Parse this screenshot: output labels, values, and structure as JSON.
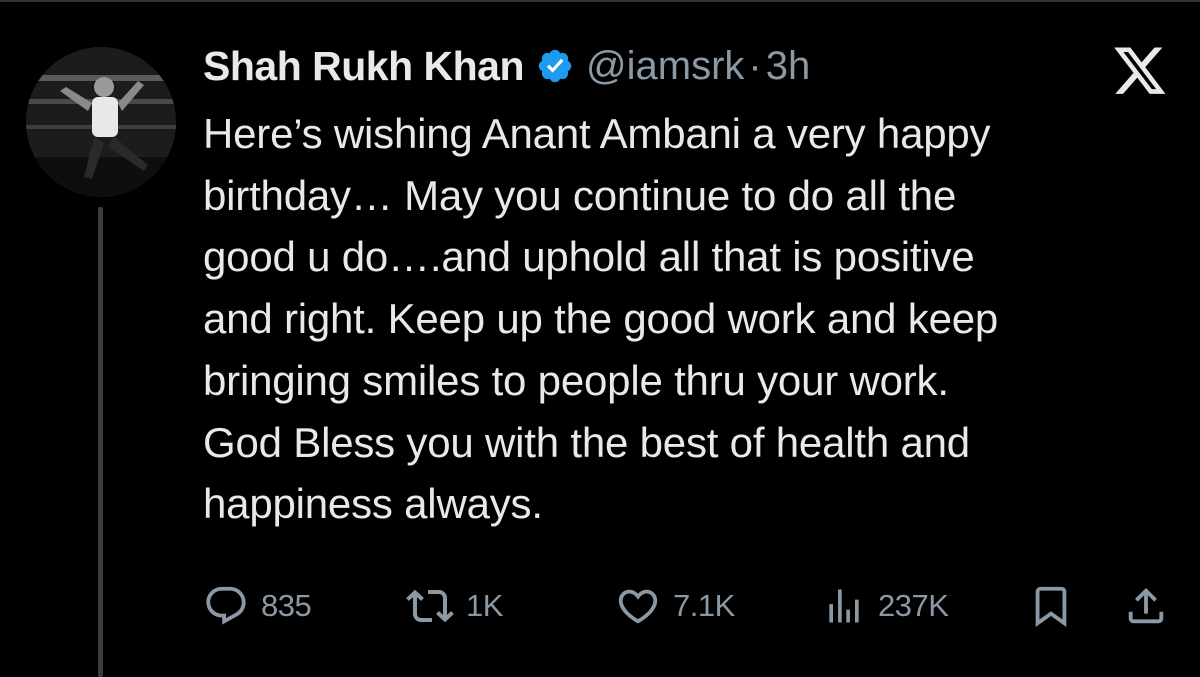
{
  "tweet": {
    "author_name": "Shah Rukh Khan",
    "handle": "@iamsrk",
    "separator": "·",
    "time": "3h",
    "text": "Here’s wishing Anant Ambani a very happy\nbirthday… May you continue to do all the\ngood u do….and uphold all that is positive\nand right. Keep up the good work and keep\nbringing smiles to people thru your work.\nGod Bless you with the best of health and\nhappiness always.",
    "verified_color": "#1d9bf0"
  },
  "icons": {
    "verified": "verified-badge-icon",
    "platform": "x-logo-icon",
    "reply": "reply-icon",
    "retweet": "retweet-icon",
    "like": "heart-icon",
    "views": "views-icon",
    "bookmark": "bookmark-icon",
    "share": "share-icon"
  },
  "actions": {
    "reply_count": "835",
    "retweet_count": "1K",
    "like_count": "7.1K",
    "views_count": "237K"
  },
  "colors": {
    "background": "#000000",
    "text": "#e7e9ea",
    "secondary": "#8b98a5",
    "thread_line": "#3a3d40"
  }
}
